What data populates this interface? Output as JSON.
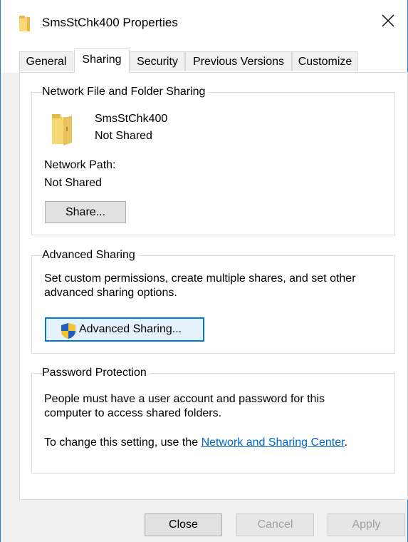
{
  "window": {
    "title": "SmsStChk400 Properties",
    "close_symbol": "✕"
  },
  "tabs": [
    {
      "label": "General",
      "active": false
    },
    {
      "label": "Sharing",
      "active": true
    },
    {
      "label": "Security",
      "active": false
    },
    {
      "label": "Previous Versions",
      "active": false
    },
    {
      "label": "Customize",
      "active": false
    }
  ],
  "network_sharing": {
    "legend": "Network File and Folder Sharing",
    "folder_name": "SmsStChk400",
    "share_status": "Not Shared",
    "path_label": "Network Path:",
    "path_value": "Not Shared",
    "share_button": "Share..."
  },
  "advanced_sharing": {
    "legend": "Advanced Sharing",
    "description_line1": "Set custom permissions, create multiple shares, and set other",
    "description_line2": "advanced sharing options.",
    "button": "Advanced Sharing..."
  },
  "password_protection": {
    "legend": "Password Protection",
    "description_line1": "People must have a user account and password for this",
    "description_line2": "computer to access shared folders.",
    "change_prefix": "To change this setting, use the ",
    "link": "Network and Sharing Center",
    "change_suffix": "."
  },
  "footer": {
    "close": "Close",
    "cancel": "Cancel",
    "apply": "Apply"
  },
  "colors": {
    "accent": "#0078d7",
    "folder": "#f8d775",
    "link": "#0066cc"
  }
}
